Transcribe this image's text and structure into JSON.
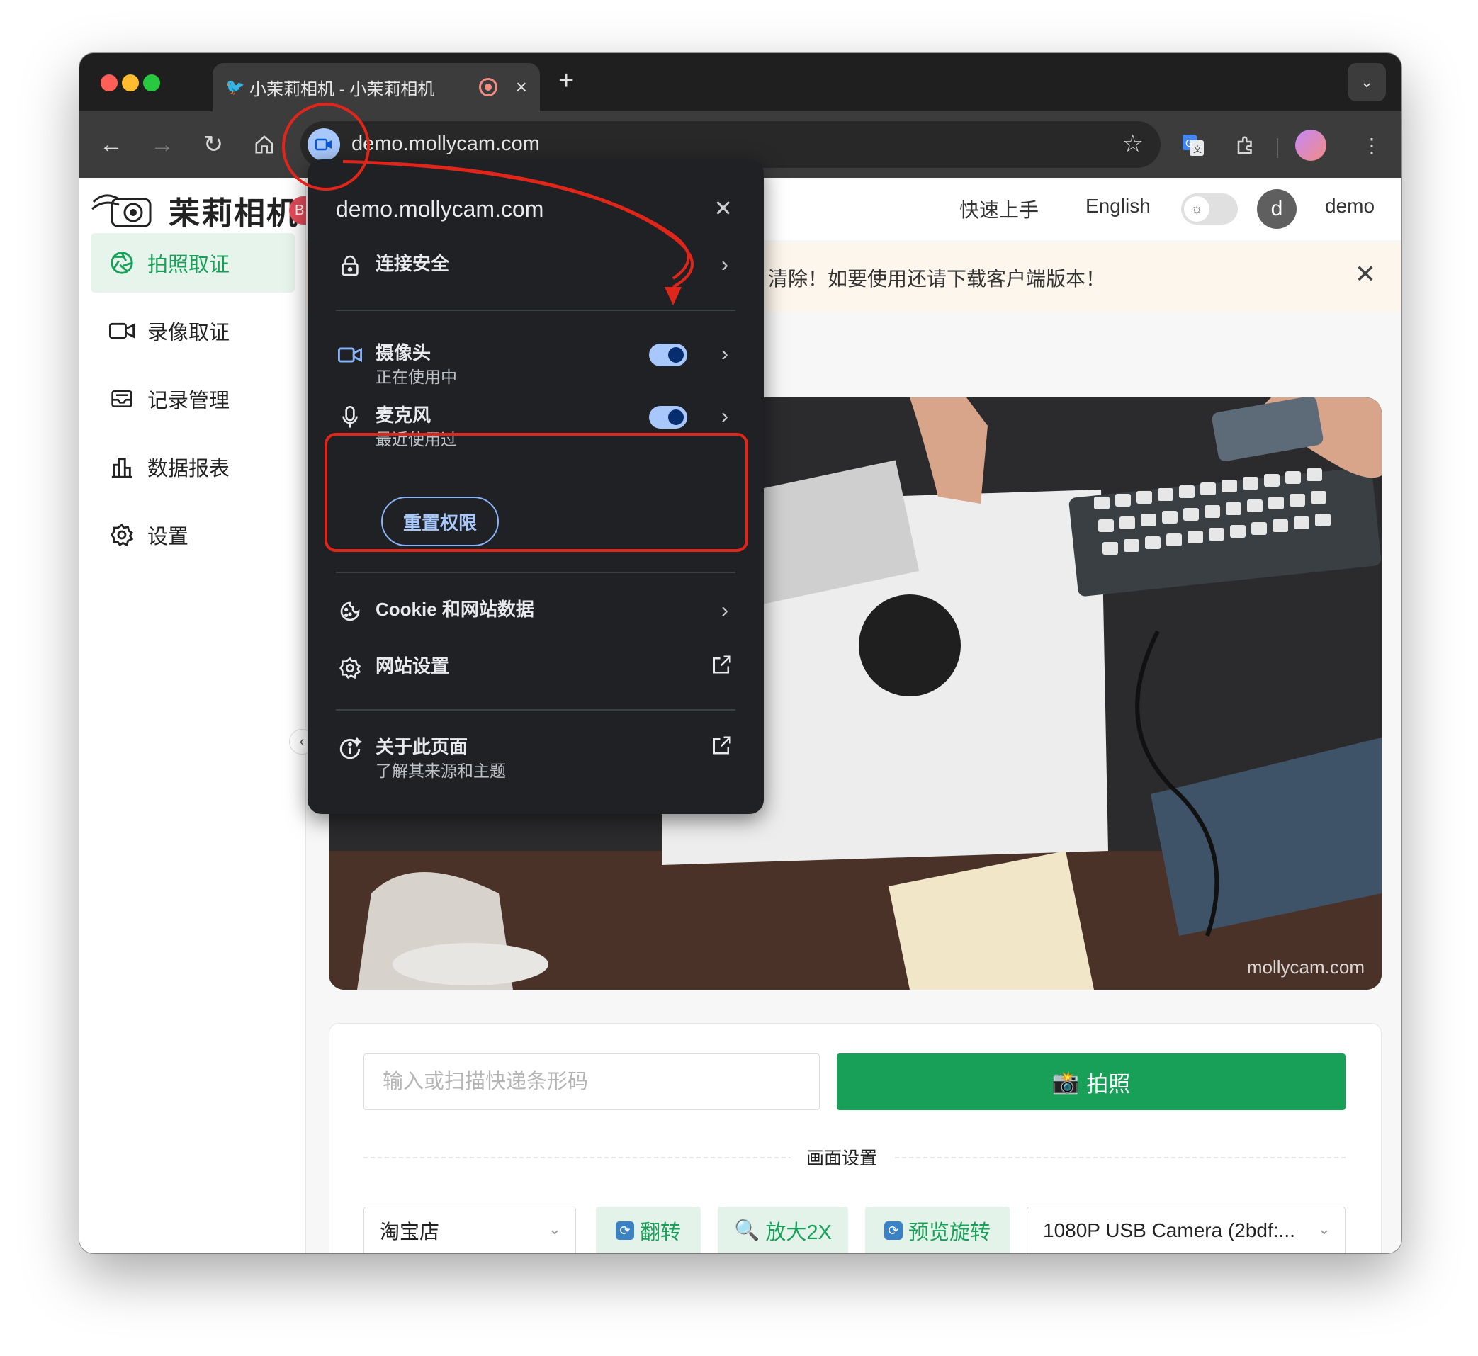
{
  "browser": {
    "tab": {
      "title": "小茉莉相机 - 小茉莉相机",
      "close": "×"
    },
    "new_tab": "+",
    "url": "demo.mollycam.com"
  },
  "app": {
    "logo_text": "茉莉相机",
    "beta_badge": "B",
    "sidebar": [
      {
        "label": "拍照取证",
        "icon": "aperture-icon",
        "active": true
      },
      {
        "label": "录像取证",
        "icon": "video-icon",
        "active": false
      },
      {
        "label": "记录管理",
        "icon": "inbox-icon",
        "active": false
      },
      {
        "label": "数据报表",
        "icon": "bar-chart-icon",
        "active": false
      },
      {
        "label": "设置",
        "icon": "gear-icon",
        "active": false
      }
    ],
    "header": {
      "quick_start": "快速上手",
      "language": "English",
      "avatar_initial": "d",
      "username": "demo"
    },
    "banner": {
      "text": "清除！如要使用还请下载客户端版本！"
    },
    "camera": {
      "watermark": "mollycam.com"
    },
    "controls": {
      "barcode_placeholder": "输入或扫描快递条形码",
      "shoot_label": "拍照",
      "section_label": "画面设置",
      "store_select": "淘宝店",
      "flip_label": "翻转",
      "zoom_label": "放大2X",
      "rotate_label": "预览旋转",
      "camera_select": "1080P USB Camera (2bdf:..."
    }
  },
  "popup": {
    "title": "demo.mollycam.com",
    "connection": "连接安全",
    "camera": {
      "label": "摄像头",
      "status": "正在使用中",
      "enabled": true
    },
    "microphone": {
      "label": "麦克风",
      "status": "最近使用过",
      "enabled": true
    },
    "reset": "重置权限",
    "cookies": "Cookie 和网站数据",
    "site_settings": "网站设置",
    "about": {
      "label": "关于此页面",
      "sub": "了解其来源和主题"
    }
  },
  "colors": {
    "accent": "#18a058",
    "highlight": "#e0261a",
    "chrome_dark": "#202124",
    "chip_blue": "#a8c7fa"
  }
}
